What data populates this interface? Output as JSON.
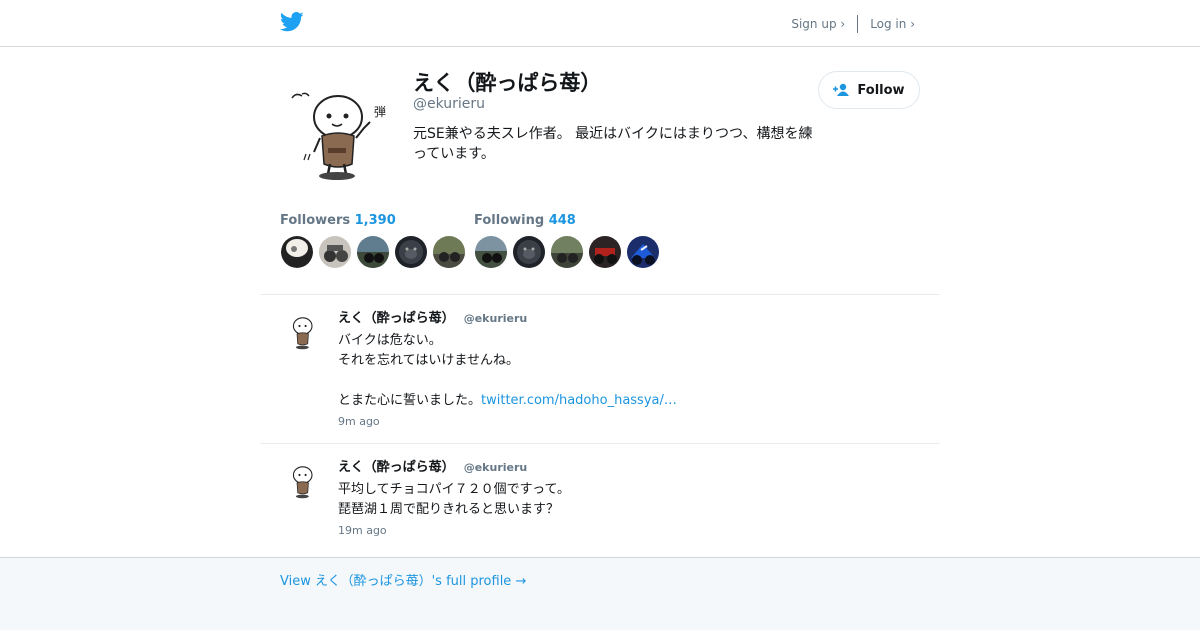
{
  "header": {
    "logo_icon": "twitter-bird-icon",
    "signup_label": "Sign up ›",
    "login_label": "Log in ›"
  },
  "profile": {
    "name": "えく（酔っぱら苺）",
    "handle": "@ekurieru",
    "bio": "元SE兼やる夫スレ作者。 最近はバイクにはまりつつ、構想を練っています。",
    "follow_label": "Follow",
    "followers_label": "Followers",
    "followers_count": "1,390",
    "following_label": "Following",
    "following_count": "448"
  },
  "colors": {
    "accent": "#1b95e0",
    "muted": "#657786",
    "footer_bg": "#f5f8fa"
  },
  "tweets": [
    {
      "name": "えく（酔っぱら苺）",
      "handle": "@ekurieru",
      "lines": [
        "バイクは危ない。",
        "それを忘れてはいけませんね。",
        "",
        "とまた心に誓いました。"
      ],
      "link": "twitter.com/hadoho_hassya/…",
      "time": "9m ago"
    },
    {
      "name": "えく（酔っぱら苺）",
      "handle": "@ekurieru",
      "lines": [
        "平均してチョコパイ７２０個ですって。",
        "琵琶湖１周で配りきれると思います？"
      ],
      "link": "",
      "time": "19m ago"
    }
  ],
  "footer": {
    "profile_link": "View えく（酔っぱら苺）'s full profile →"
  }
}
